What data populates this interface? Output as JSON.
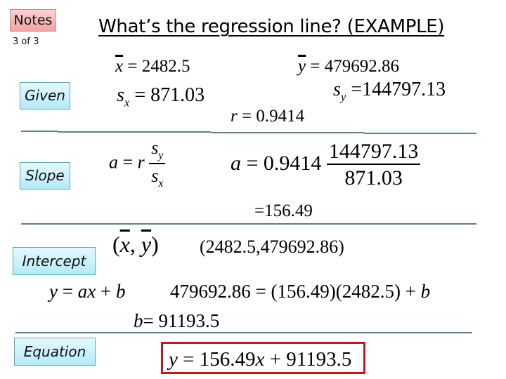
{
  "header": {
    "notes_label": "Notes",
    "page_indicator": "3 of 3",
    "title": "What’s the regression line? (EXAMPLE)"
  },
  "sections": {
    "given": {
      "label": "Given",
      "x_mean": {
        "symbol": "x",
        "value": "2482.5"
      },
      "y_mean": {
        "symbol": "y",
        "value": "479692.86"
      },
      "sx": {
        "symbol": "s",
        "subscript": "x",
        "value": "871.03"
      },
      "sy": {
        "symbol": "s",
        "subscript": "y",
        "value": "144797.13"
      },
      "r": {
        "symbol": "r",
        "value": "0.9414"
      }
    },
    "slope": {
      "label": "Slope",
      "formula": {
        "lhs": "a",
        "coef": "r",
        "num_sym": "s",
        "num_sub": "y",
        "den_sym": "s",
        "den_sub": "x"
      },
      "substitution": {
        "lhs": "a",
        "coef": "0.9414",
        "numerator": "144797.13",
        "denominator": "871.03"
      },
      "result": "=156.49"
    },
    "intercept": {
      "label": "Intercept",
      "point_symbol": {
        "open": "(",
        "x": "x",
        "sep": ",",
        "y": "y",
        "close": ")"
      },
      "point_values": "(2482.5,479692.86)",
      "line_form": {
        "y": "y",
        "eq": "=",
        "a": "a",
        "x": "x",
        "plus": "+",
        "b": "b"
      },
      "substitution": "479692.86 = (156.49)(2482.5) + ",
      "substitution_var": "b",
      "result_var": "b",
      "result_value": "= 91193.5"
    },
    "equation": {
      "label": "Equation",
      "y": "y",
      "eq": " = 156.49",
      "x": "x",
      "rest": " + 91193.5",
      "highlight_color": "#c8161d"
    }
  }
}
